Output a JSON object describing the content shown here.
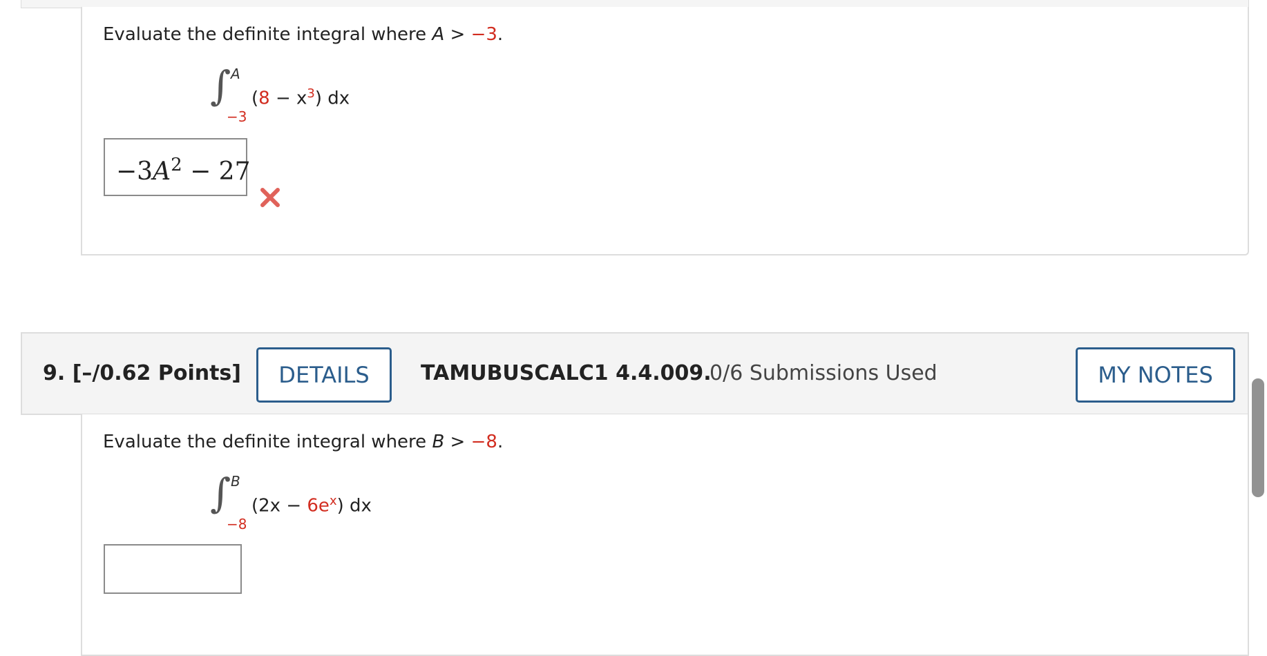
{
  "previous_question": {
    "prompt_prefix": "Evaluate the definite integral where ",
    "variable": "A",
    "relation": " > ",
    "bound_value": "−3",
    "period": ".",
    "integral": {
      "upper": "A",
      "lower": "−3",
      "open_paren": "(",
      "term1": "8",
      "op": " − x",
      "exponent": "3",
      "close": ") dx"
    },
    "answer": {
      "neg": "−3",
      "var": "A",
      "exp": "2",
      "rest": " − 27"
    },
    "status": "incorrect"
  },
  "question_header": {
    "number_points": "9.  [–/0.62 Points]",
    "details_label": "DETAILS",
    "code": "TAMUBUSCALC1 4.4.009.",
    "submissions": "0/6 Submissions Used",
    "notes_label": "MY NOTES"
  },
  "current_question": {
    "prompt_prefix": "Evaluate the definite integral where ",
    "variable": "B",
    "relation": " > ",
    "bound_value": "−8",
    "period": ".",
    "integral": {
      "upper": "B",
      "lower": "−8",
      "open": "(2x − ",
      "term2": "6e",
      "exponent": "x",
      "close": ") dx"
    },
    "answer_value": ""
  },
  "colors": {
    "accent": "#2b5d8c",
    "highlight_red": "#d22d20",
    "incorrect_mark": "#e0625a"
  }
}
